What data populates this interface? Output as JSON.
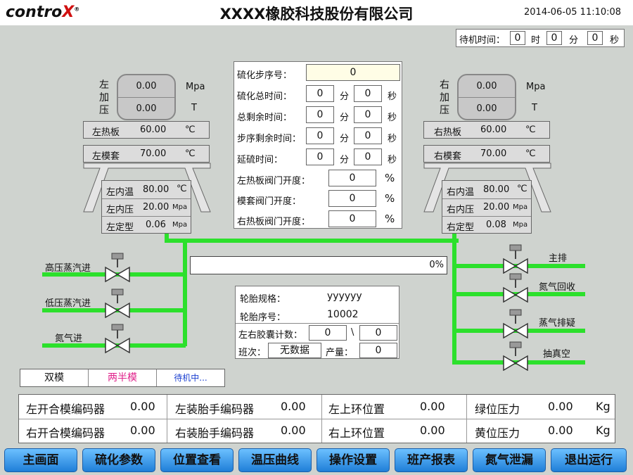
{
  "header": {
    "logo_prefix": "contro",
    "logo_x": "X",
    "logo_mark": "®",
    "title": "XXXX橡胶科技股份有限公司",
    "datetime": "2014-06-05 11:10:08"
  },
  "standby": {
    "label": "待机时间：",
    "hours": "0",
    "h_unit": "时",
    "minutes": "0",
    "m_unit": "分",
    "seconds": "0",
    "s_unit": "秒"
  },
  "left": {
    "title": "左加压",
    "gauge_top": "0.00",
    "gauge_bot": "0.00",
    "unit_top": "Mpa",
    "unit_bot": "T",
    "platen": {
      "label": "左热板",
      "value": "60.00",
      "unit": "℃"
    },
    "jacket": {
      "label": "左模套",
      "value": "70.00",
      "unit": "℃"
    },
    "inner_temp": {
      "label": "左内温",
      "value": "80.00",
      "unit": "℃"
    },
    "inner_press": {
      "label": "左内压",
      "value": "20.00",
      "unit": "Mpa"
    },
    "shaping": {
      "label": "左定型",
      "value": "0.06",
      "unit": "Mpa"
    }
  },
  "right": {
    "title": "右加压",
    "gauge_top": "0.00",
    "gauge_bot": "0.00",
    "unit_top": "Mpa",
    "unit_bot": "T",
    "platen": {
      "label": "右热板",
      "value": "60.00",
      "unit": "℃"
    },
    "jacket": {
      "label": "右模套",
      "value": "70.00",
      "unit": "℃"
    },
    "inner_temp": {
      "label": "右内温",
      "value": "80.00",
      "unit": "℃"
    },
    "inner_press": {
      "label": "右内压",
      "value": "20.00",
      "unit": "Mpa"
    },
    "shaping": {
      "label": "右定型",
      "value": "0.08",
      "unit": "Mpa"
    }
  },
  "cure": {
    "step_label": "硫化步序号：",
    "step_value": "0",
    "times": [
      {
        "label": "硫化总时间：",
        "min": "0",
        "min_unit": "分",
        "sec": "0",
        "sec_unit": "秒"
      },
      {
        "label": "总剩余时间：",
        "min": "0",
        "min_unit": "分",
        "sec": "0",
        "sec_unit": "秒"
      },
      {
        "label": "步序剩余时间：",
        "min": "0",
        "min_unit": "分",
        "sec": "0",
        "sec_unit": "秒"
      },
      {
        "label": "延硫时间：",
        "min": "0",
        "min_unit": "分",
        "sec": "0",
        "sec_unit": "秒"
      }
    ],
    "valves": [
      {
        "label": "左热板阀门开度：",
        "value": "0",
        "unit": "%"
      },
      {
        "label": "模套阀门开度：",
        "value": "0",
        "unit": "%"
      },
      {
        "label": "右热板阀门开度：",
        "value": "0",
        "unit": "%"
      }
    ]
  },
  "progress": {
    "text": "0%",
    "fraction": 0
  },
  "lines_left": [
    "高压蒸汽进",
    "低压蒸汽进",
    "氮气进"
  ],
  "lines_right": [
    "主排",
    "氮气回收",
    "蒸气排疑",
    "抽真空"
  ],
  "tire": {
    "spec_label": "轮胎规格：",
    "spec_value": "yyyyyy",
    "seq_label": "轮胎序号：",
    "seq_value": "10002",
    "bladder_label": "左右胶囊计数：",
    "bladder_left": "0",
    "bladder_sep": "\\",
    "bladder_right": "0",
    "shift_label": "班次：",
    "shift_value": "无数据",
    "output_label": "产量：",
    "output_value": "0"
  },
  "status_tabs": [
    "双模",
    "两半模",
    "待机中..."
  ],
  "status_colors": {
    "tab2": "#e0208a",
    "tab3": "#1a3fd0"
  },
  "encoders": [
    {
      "label": "左开合模编码器",
      "value": "0.00"
    },
    {
      "label": "右开合模编码器",
      "value": "0.00"
    },
    {
      "label": "左装胎手编码器",
      "value": "0.00"
    },
    {
      "label": "右装胎手编码器",
      "value": "0.00"
    },
    {
      "label": "左上环位置",
      "value": "0.00"
    },
    {
      "label": "右上环位置",
      "value": "0.00"
    },
    {
      "label": "绿位压力",
      "value": "0.00",
      "unit": "Kg"
    },
    {
      "label": "黄位压力",
      "value": "0.00",
      "unit": "Kg"
    }
  ],
  "nav": [
    "主画面",
    "硫化参数",
    "位置查看",
    "温压曲线",
    "操作设置",
    "班产报表",
    "氮气泄漏",
    "退出运行"
  ],
  "colors": {
    "pipe": "#2ce02c",
    "background": "#cfd3cf",
    "nav": "#3d9bf0"
  }
}
